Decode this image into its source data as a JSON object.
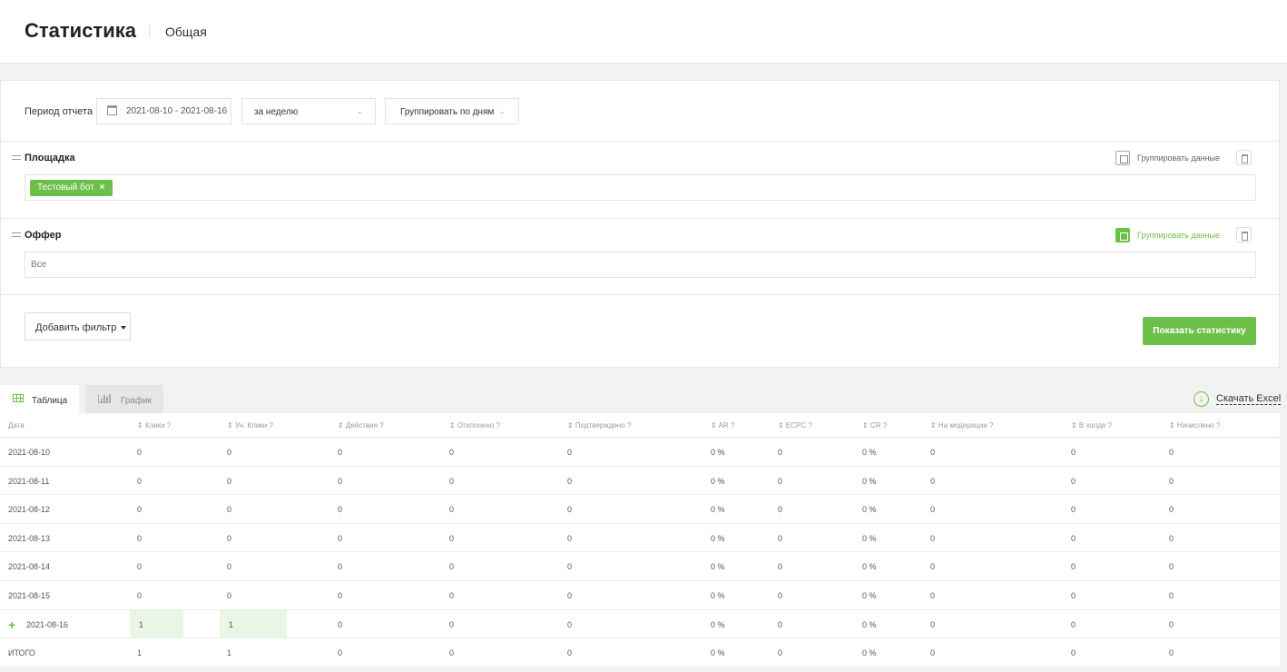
{
  "header": {
    "title": "Статистика",
    "subtitle": "Общая"
  },
  "period": {
    "label": "Период отчета",
    "date_range": "2021-08-10 - 2021-08-16",
    "range_select": "за неделю",
    "group_select": "Группировать по дням",
    "calendar_icon": "calendar-icon",
    "chevron_icon": "chevron-down-icon"
  },
  "filters": [
    {
      "title": "Площадка",
      "group_label": "Группировать данные",
      "group_active": false,
      "tags": [
        {
          "label": "Тестовый бот",
          "remove": "×"
        }
      ]
    },
    {
      "title": "Оффер",
      "group_label": "Группировать данные",
      "group_active": true,
      "value": "Все"
    }
  ],
  "actions": {
    "add_filter": "Добавить фильтр",
    "show_stats": "Показать статистику"
  },
  "tabs": [
    {
      "label": "Таблица",
      "active": true
    },
    {
      "label": "График",
      "active": false
    }
  ],
  "download": {
    "label": "Скачать Excel",
    "icon": "↓"
  },
  "table": {
    "columns": [
      "Дата",
      "⇕ Клики ?",
      "⇕ Ун. Клики ?",
      "⇕ Действия ?",
      "⇕ Отклонено ?",
      "⇕ Подтверждено ?",
      "⇕ AR ?",
      "⇕ ECPC ?",
      "⇕ CR ?",
      "⇕ На модерации ?",
      "⇕ В холде ?",
      "⇕ Начислено ?"
    ],
    "rows": [
      {
        "cells": [
          "2021-08-10",
          "0",
          "0",
          "0",
          "0",
          "0",
          "0 %",
          "0",
          "0 %",
          "0",
          "0",
          "0"
        ],
        "expand": ""
      },
      {
        "cells": [
          "2021-08-11",
          "0",
          "0",
          "0",
          "0",
          "0",
          "0 %",
          "0",
          "0 %",
          "0",
          "0",
          "0"
        ],
        "expand": ""
      },
      {
        "cells": [
          "2021-08-12",
          "0",
          "0",
          "0",
          "0",
          "0",
          "0 %",
          "0",
          "0 %",
          "0",
          "0",
          "0"
        ],
        "expand": ""
      },
      {
        "cells": [
          "2021-08-13",
          "0",
          "0",
          "0",
          "0",
          "0",
          "0 %",
          "0",
          "0 %",
          "0",
          "0",
          "0"
        ],
        "expand": ""
      },
      {
        "cells": [
          "2021-08-14",
          "0",
          "0",
          "0",
          "0",
          "0",
          "0 %",
          "0",
          "0 %",
          "0",
          "0",
          "0"
        ],
        "expand": ""
      },
      {
        "cells": [
          "2021-08-15",
          "0",
          "0",
          "0",
          "0",
          "0",
          "0 %",
          "0",
          "0 %",
          "0",
          "0",
          "0"
        ],
        "expand": ""
      },
      {
        "cells": [
          "2021-08-16",
          "1",
          "1",
          "0",
          "0",
          "0",
          "0 %",
          "0",
          "0 %",
          "0",
          "0",
          "0"
        ],
        "expand": "+"
      },
      {
        "cells": [
          "ИТОГО",
          "1",
          "1",
          "0",
          "0",
          "0",
          "0 %",
          "0",
          "0 %",
          "0",
          "0",
          "0"
        ],
        "expand": ""
      }
    ]
  },
  "colors": {
    "accent": "#6cc04a",
    "highlight": "#e9f6e4"
  }
}
